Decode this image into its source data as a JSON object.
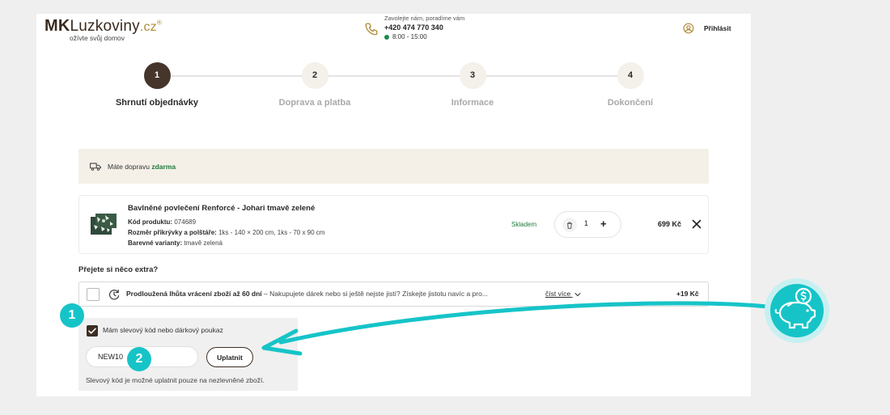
{
  "header": {
    "logo": {
      "mk": "MK",
      "name": "Luzkoviny",
      "tld": ".cz",
      "reg": "®",
      "tagline": "ožívte svůj domov"
    },
    "contact": {
      "note": "Zavolejte nám, poradíme vám",
      "phone": "+420 474 770 340",
      "hours": "8:00 - 15:00",
      "status_color": "#1e8a47"
    },
    "login_label": "Přihlásit"
  },
  "steps": [
    {
      "number": "1",
      "label": "Shrnutí objednávky",
      "active": true
    },
    {
      "number": "2",
      "label": "Doprava a platba",
      "active": false
    },
    {
      "number": "3",
      "label": "Informace",
      "active": false
    },
    {
      "number": "4",
      "label": "Dokončení",
      "active": false
    }
  ],
  "shipping": {
    "text": "Máte dopravu",
    "highlight": "zdarma"
  },
  "cart_item": {
    "title": "Bavlněné povlečení Renforcé - Johari tmavě zelené",
    "code_label": "Kód produktu:",
    "code": "074689",
    "size_label": "Rozměr přikrývky a polštáře:",
    "size": "1ks - 140 × 200 cm, 1ks - 70 x 90 cm",
    "variant_label": "Barevné varianty:",
    "variant": "tmavě zelená",
    "stock": "Skladem",
    "quantity": "1",
    "plus": "+",
    "price": "699 Kč"
  },
  "extras": {
    "title": "Přejete si něco extra?",
    "item": {
      "name": "Prodloužená lhůta vrácení zboží až 60 dní",
      "description": " – Nakupujete dárek nebo si ještě nejste jistí? Získejte jistotu navíc a pro...",
      "more": "číst více",
      "price": "+19 Kč",
      "checked": false
    }
  },
  "discount": {
    "checked": true,
    "label": "Mám slevový kód nebo dárkový poukaz",
    "input_value": "NEW10",
    "apply_label": "Uplatnit",
    "note": "Slevový kód je možné uplatnit pouze na nezlevněné zboží."
  },
  "annotations": {
    "badge_1": "1",
    "badge_2": "2",
    "accent_color": "#16c4c8"
  },
  "colors": {
    "brand_brown": "#45352b",
    "beige": "#f4f0e8",
    "green": "#1e7a3c",
    "gold": "#b08b3a"
  }
}
